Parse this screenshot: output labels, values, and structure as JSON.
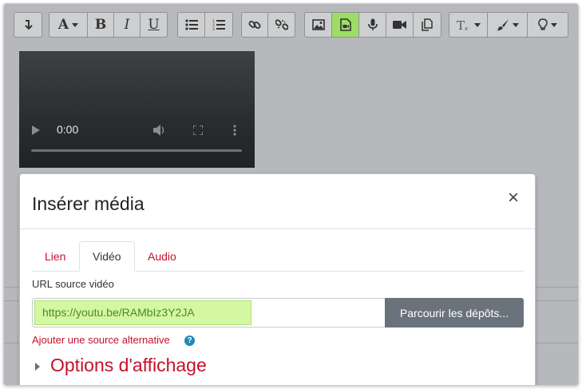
{
  "toolbar": {
    "groups": [
      {
        "buttons": [
          {
            "icon": "collapse-icon"
          }
        ]
      },
      {
        "buttons": [
          {
            "icon": "font-size-icon",
            "label": "A"
          },
          {
            "icon": "bold-icon",
            "label": "B"
          },
          {
            "icon": "italic-icon",
            "label": "I"
          },
          {
            "icon": "underline-icon",
            "label": "U"
          }
        ]
      },
      {
        "buttons": [
          {
            "icon": "bullet-list-icon"
          },
          {
            "icon": "numbered-list-icon"
          }
        ]
      },
      {
        "buttons": [
          {
            "icon": "link-icon"
          },
          {
            "icon": "unlink-icon"
          }
        ]
      },
      {
        "buttons": [
          {
            "icon": "image-icon"
          },
          {
            "icon": "media-icon",
            "active": true
          },
          {
            "icon": "microphone-icon"
          },
          {
            "icon": "video-camera-icon"
          },
          {
            "icon": "manage-files-icon"
          }
        ]
      },
      {
        "buttons": [
          {
            "icon": "clear-format-icon"
          },
          {
            "icon": "paintbrush-icon"
          },
          {
            "icon": "lightbulb-icon"
          }
        ]
      }
    ],
    "active_color": "#9fdc66"
  },
  "video_player": {
    "time": "0:00"
  },
  "modal": {
    "title": "Insérer média",
    "close_label": "×",
    "tabs": [
      {
        "label": "Lien",
        "active": false
      },
      {
        "label": "Vidéo",
        "active": true
      },
      {
        "label": "Audio",
        "active": false
      }
    ],
    "url_label": "URL source vidéo",
    "url_value": "https://youtu.be/RAMbIz3Y2JA",
    "browse_button": "Parcourir les dépôts...",
    "alt_source_link": "Ajouter une source alternative",
    "help_icon": "?",
    "options_title": "Options d'affichage",
    "accent_color": "#c5112a"
  }
}
